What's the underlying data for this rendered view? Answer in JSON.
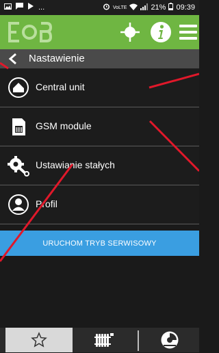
{
  "status_bar": {
    "dots": "...",
    "battery": "21%",
    "time": "09:39"
  },
  "header": {
    "title": "Nastawienie"
  },
  "menu": {
    "items": [
      {
        "label": "Central unit"
      },
      {
        "label": "GSM module"
      },
      {
        "label": "Ustawianie stałych"
      },
      {
        "label": "Profil"
      }
    ]
  },
  "service_button": {
    "label": "URUCHOM TRYB SERWISOWY"
  },
  "bottom_nav": {
    "tabs": [
      "star-icon",
      "radiator-icon",
      "dial-icon"
    ],
    "active_index": 0
  },
  "colors": {
    "appbar": "#6fb642",
    "service_button": "#3a9ee1",
    "annotation": "#e0182a"
  }
}
